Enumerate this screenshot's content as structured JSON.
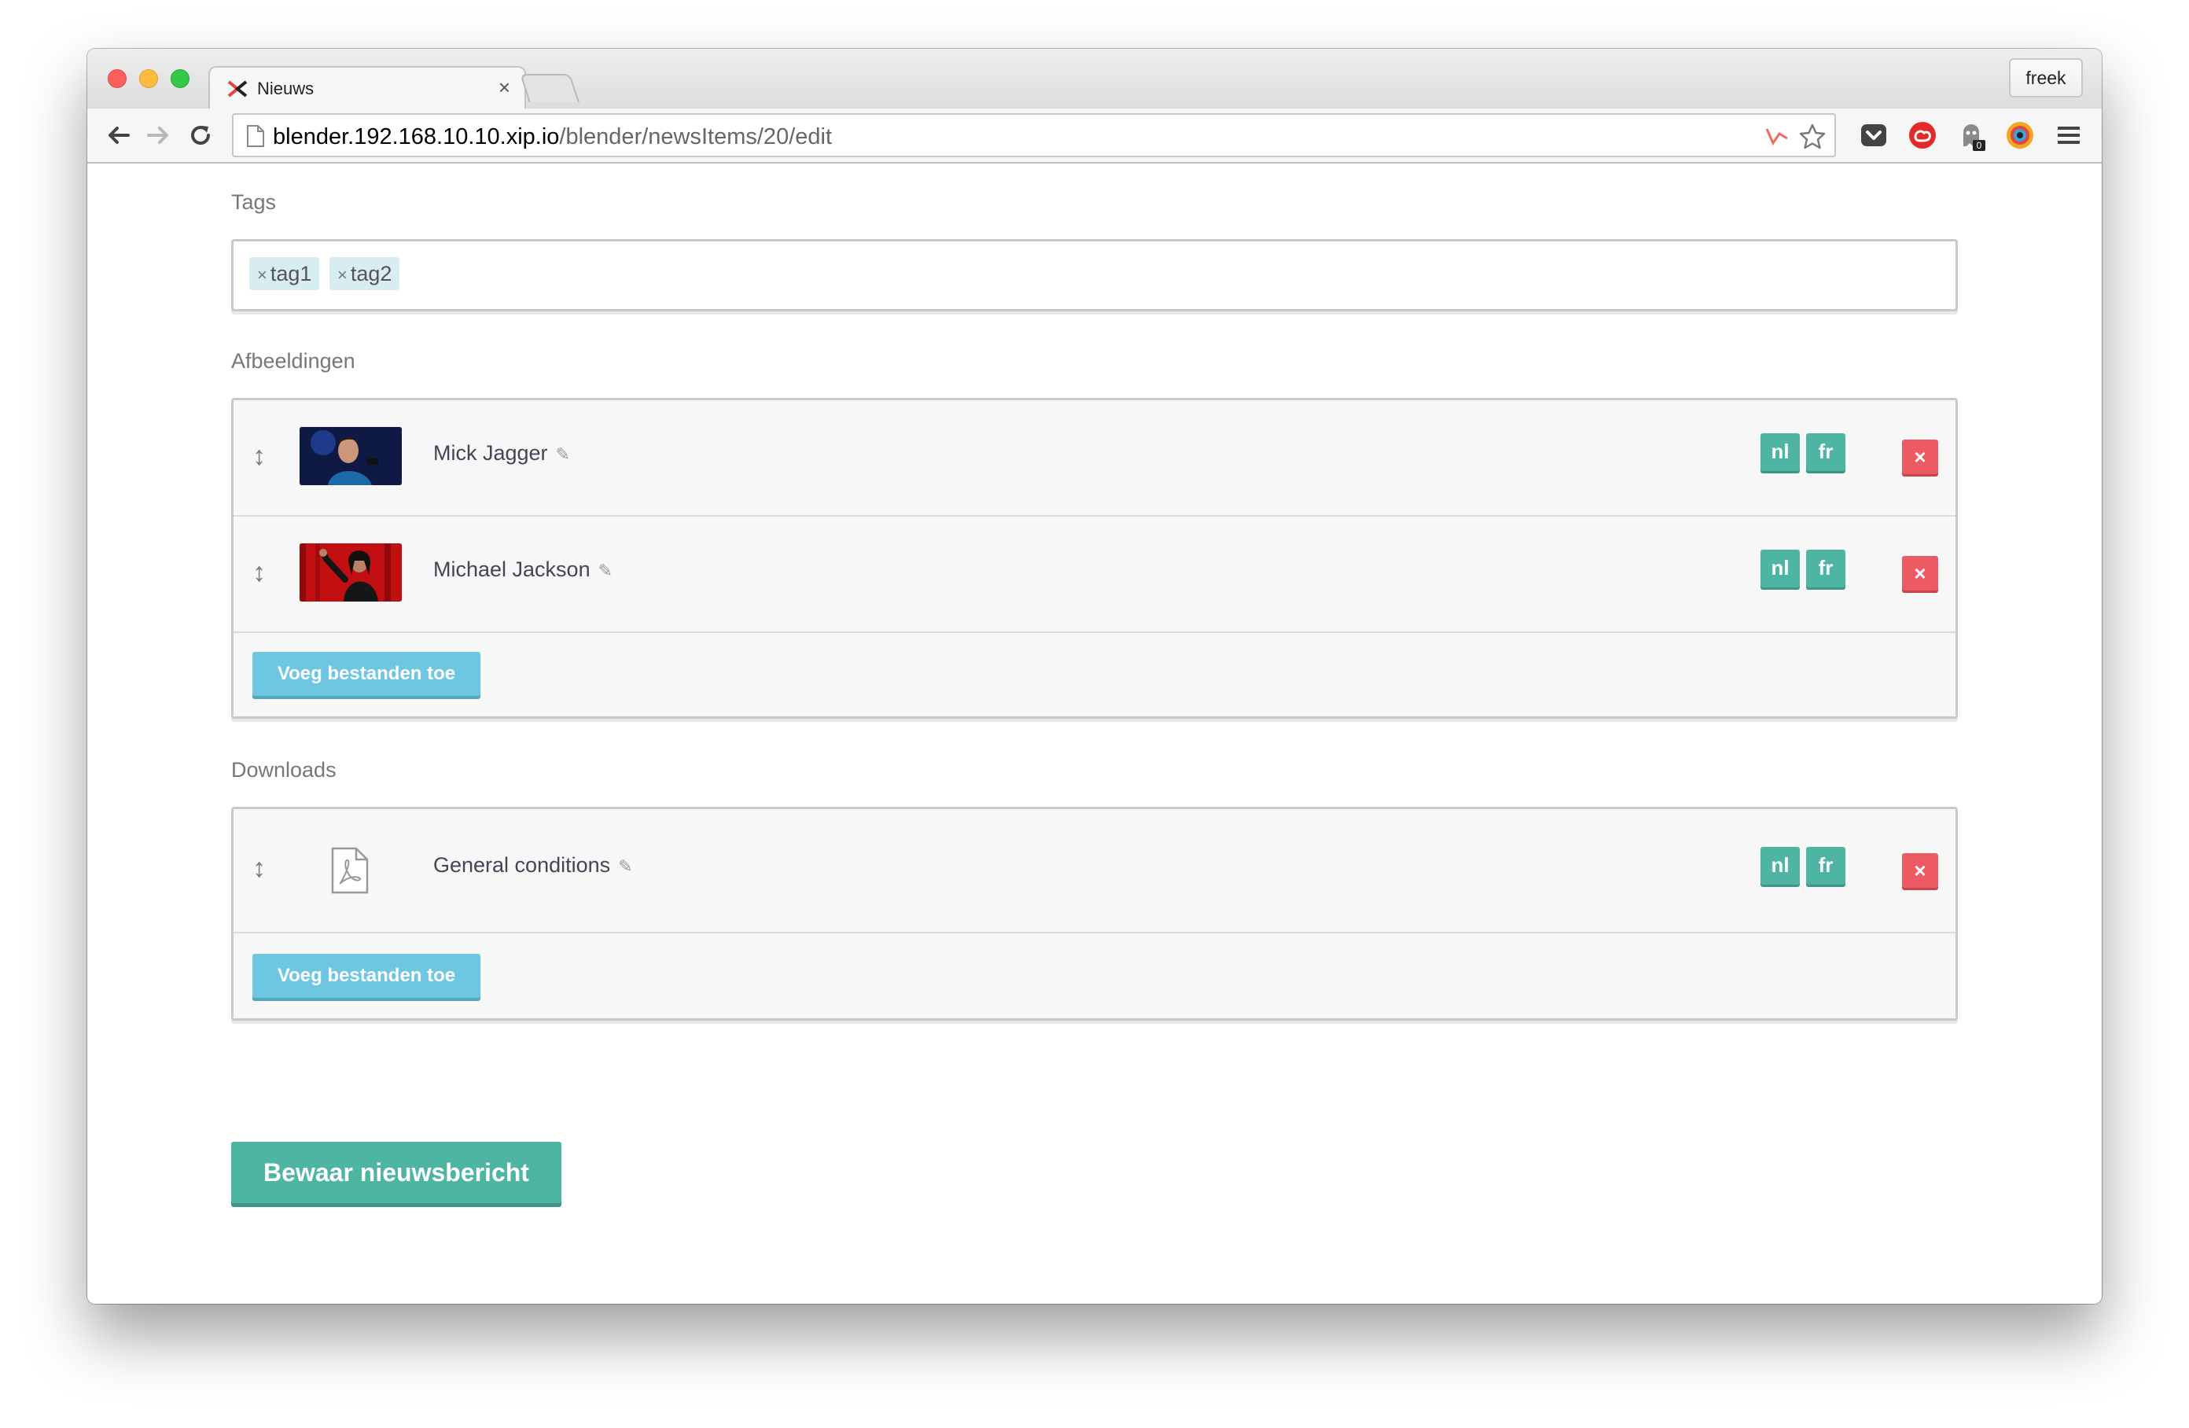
{
  "browser": {
    "tab_title": "Nieuws",
    "tab_close": "×",
    "profile_name": "freek",
    "url_host": "blender.192.168.10.10.xip.io",
    "url_path": "/blender/newsItems/20/edit",
    "extension_badge": "0"
  },
  "tags": {
    "label": "Tags",
    "items": [
      {
        "remove": "×",
        "text": "tag1"
      },
      {
        "remove": "×",
        "text": "tag2"
      }
    ]
  },
  "images": {
    "label": "Afbeeldingen",
    "items": [
      {
        "name": "Mick Jagger",
        "langs": [
          "nl",
          "fr"
        ],
        "delete": "×"
      },
      {
        "name": "Michael Jackson",
        "langs": [
          "nl",
          "fr"
        ],
        "delete": "×"
      }
    ],
    "add_label": "Voeg bestanden toe"
  },
  "downloads": {
    "label": "Downloads",
    "items": [
      {
        "name": "General conditions",
        "langs": [
          "nl",
          "fr"
        ],
        "delete": "×"
      }
    ],
    "add_label": "Voeg bestanden toe"
  },
  "save_label": "Bewaar nieuwsbericht",
  "colors": {
    "teal": "#4fb5a3",
    "blue_button": "#6dc7e0",
    "delete_red": "#ec5b64",
    "tag_bg": "#d8edf1"
  },
  "icons": {
    "drag": "↕",
    "pencil": "✎"
  }
}
